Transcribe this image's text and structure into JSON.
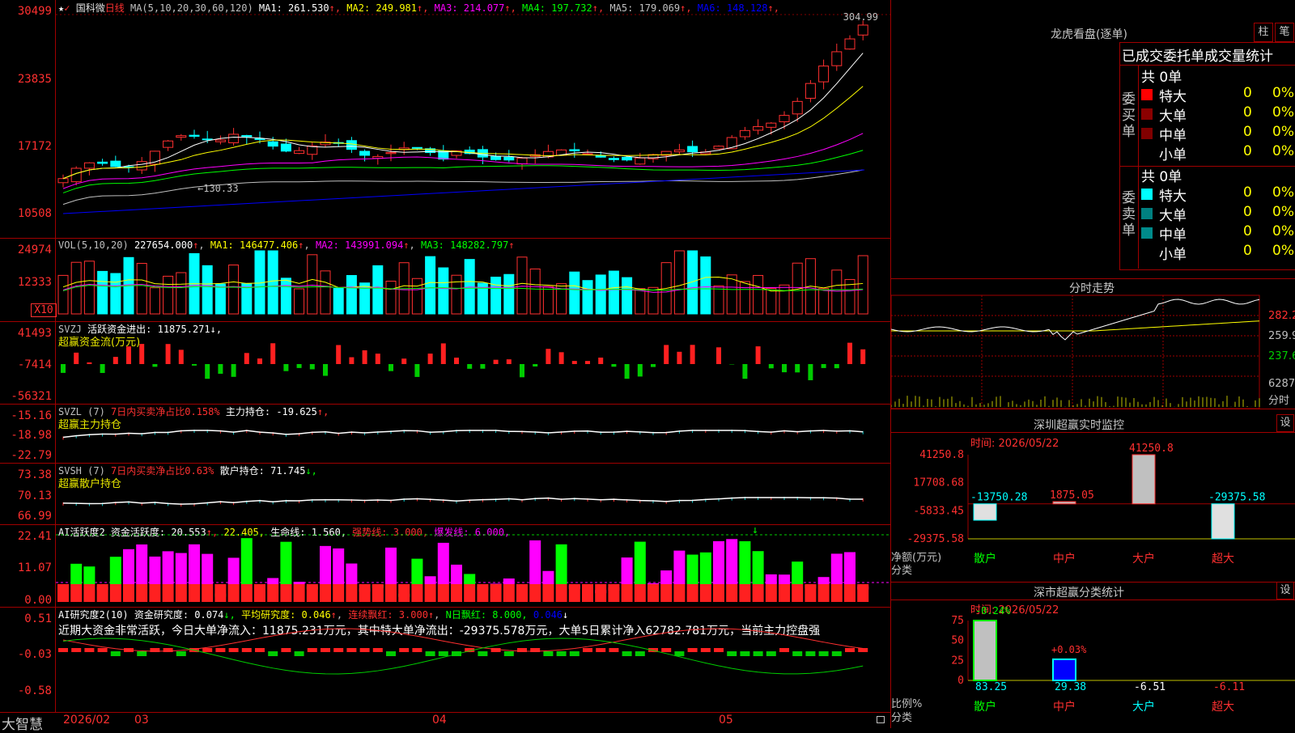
{
  "stock": {
    "star": "★",
    "flag": "✓",
    "name": "国科微",
    "period": "日线",
    "ma_params": "MA(5,10,20,30,60,120)",
    "ma": [
      {
        "label": "MA1:",
        "value": "261.530",
        "color": "#ffffff"
      },
      {
        "label": "MA2:",
        "value": "249.981",
        "color": "#ffff00"
      },
      {
        "label": "MA3:",
        "value": "214.077",
        "color": "#ff00ff"
      },
      {
        "label": "MA4:",
        "value": "197.732",
        "color": "#00ff00"
      },
      {
        "label": "MA5:",
        "value": "179.069",
        "color": "#c0c0c0"
      },
      {
        "label": "MA6:",
        "value": "148.128",
        "color": "#0000ff"
      }
    ],
    "up_arrow": "↑",
    "down_arrow": "↓",
    "high_label": "304.99",
    "low_label": "130.33",
    "y_ticks": [
      "30499",
      "23835",
      "17172",
      "10508"
    ]
  },
  "volume": {
    "header": "VOL(5,10,20)",
    "value": "227654.000",
    "ma1": "MA1: 146477.406",
    "ma2": "MA2: 143991.094",
    "ma3": "MA3: 148282.797",
    "y_ticks": [
      "24974",
      "12333"
    ],
    "unit": "X10"
  },
  "svzj": {
    "name": "SVZJ",
    "label": "活跃资金进出:",
    "value": "11875.271",
    "arrow": "↓,",
    "sub": "超赢资金流(万元)",
    "y_ticks": [
      "41493",
      "-7414",
      "-56321"
    ]
  },
  "svzl": {
    "name": "SVZL (7)",
    "pct": "7日内买卖净占比0.158%",
    "label": "主力持仓:",
    "value": "-19.625",
    "arrow": "↑,",
    "sub": "超赢主力持仓",
    "y_ticks": [
      "-15.16",
      "-18.98",
      "-22.79"
    ]
  },
  "svsh": {
    "name": "SVSH (7)",
    "pct": "7日内买卖净占比0.63%",
    "label": "散户持仓:",
    "value": "71.745",
    "arrow": "↓,",
    "sub": "超赢散户持仓",
    "y_ticks": [
      "73.38",
      "70.13",
      "66.99"
    ]
  },
  "ai": {
    "name": "AI活跃度2",
    "label": "资金活跃度:",
    "value": "20.553",
    "arrow": "↑,",
    "v2": "22.405,",
    "life": "生命线: 1.560,",
    "strong": "强势线: 3.000,",
    "burst": "爆发线: 6.000,",
    "y_ticks": [
      "22.41",
      "11.07",
      "0.00"
    ]
  },
  "air": {
    "name": "AI研究度2(10)",
    "label": "资金研究度:",
    "value": "0.074",
    "arrow": "↓,",
    "avg": "平均研究度: 0.046",
    "cont": "连续飘红: 3.000",
    "nday": "N日飘红: 8.000,",
    "last": "0.046",
    "note": "近期大资金非常活跃，今日大单净流入：11875.231万元，其中特大单净流出：-29375.578万元，大单5日累计净入62782.781万元，当前主力控盘强",
    "y_ticks": [
      "0.51",
      "-0.03",
      "-0.58"
    ]
  },
  "bottom": {
    "logo": "大智慧",
    "date": "2026/02",
    "months": [
      "03",
      "04",
      "05"
    ]
  },
  "dragon": {
    "title": "龙虎看盘(逐单)",
    "btn1": "柱",
    "btn2": "笔",
    "stat_title": "已成交委托单成交量统计",
    "buy": {
      "side": "委买单",
      "total": "共 0单",
      "rows": [
        {
          "name": "特大",
          "v": "0",
          "p": "0%",
          "color": "#ff0000"
        },
        {
          "name": "大单",
          "v": "0",
          "p": "0%",
          "color": "#8b0000"
        },
        {
          "name": "中单",
          "v": "0",
          "p": "0%",
          "color": "#800000"
        },
        {
          "name": "小单",
          "v": "0",
          "p": "0%",
          "color": "#000000"
        }
      ]
    },
    "sell": {
      "side": "委卖单",
      "total": "共 0单",
      "rows": [
        {
          "name": "特大",
          "v": "0",
          "p": "0%",
          "color": "#00ffff"
        },
        {
          "name": "大单",
          "v": "0",
          "p": "0%",
          "color": "#008080"
        },
        {
          "name": "中单",
          "v": "0",
          "p": "0%",
          "color": "#008b8b"
        },
        {
          "name": "小单",
          "v": "0",
          "p": "0%",
          "color": "#000000"
        }
      ]
    }
  },
  "intraday": {
    "title": "分时走势",
    "y1": "282.2",
    "y2": "259.9",
    "y3": "237.6",
    "vol": "6287",
    "vol_unit": "分时"
  },
  "monitor": {
    "title": "深圳超赢实时监控",
    "btn": "设",
    "time": "时间: 2026/05/22",
    "y_ticks": [
      "41250.8",
      "17708.68",
      "-5833.45",
      "-29375.58"
    ],
    "y_label": "净额(万元)",
    "x_label": "分类",
    "cats": [
      "散户",
      "中户",
      "大户",
      "超大"
    ],
    "values": [
      "-13750.28",
      "1875.05",
      "41250.8",
      "-29375.58"
    ]
  },
  "classify": {
    "title": "深市超赢分类统计",
    "btn": "设",
    "time": "时间: 2026/05/22",
    "y_ticks": [
      "75",
      "50",
      "25",
      "0"
    ],
    "y_label": "比例%",
    "x_label": "分类",
    "cats": [
      "散户",
      "中户",
      "大户",
      "超大"
    ],
    "top_vals": [
      "-0.24%",
      "+0.03%"
    ],
    "bottom_vals": [
      "83.25",
      "29.38",
      "-6.51",
      "-6.11"
    ]
  }
}
